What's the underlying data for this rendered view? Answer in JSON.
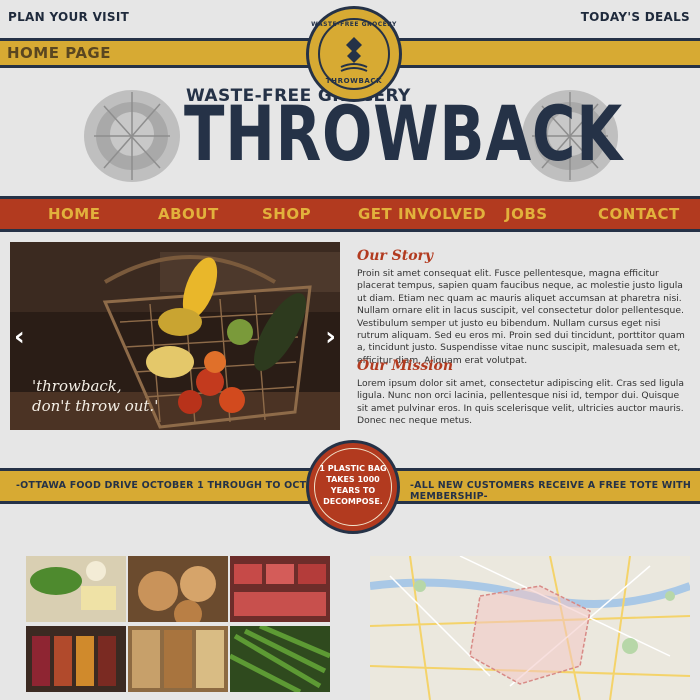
{
  "topbar": {
    "left_link": "PLAN YOUR VISIT",
    "right_link": "TODAY'S DEALS"
  },
  "home_band": {
    "label": "HOME PAGE"
  },
  "seal": {
    "ring_top": "WASTE-FREE GROCERY",
    "ring_bottom": "THROWBACK"
  },
  "header": {
    "tagline": "WASTE-FREE GROCERY",
    "brand": "THROWBACK"
  },
  "nav": {
    "items": [
      "HOME",
      "ABOUT",
      "SHOP",
      "GET INVOLVED",
      "JOBS",
      "CONTACT"
    ]
  },
  "slider": {
    "caption_line1": "'throwback,",
    "caption_line2": "don't throw out.'",
    "prev_icon": "chevron-left-icon",
    "next_icon": "chevron-right-icon"
  },
  "story": {
    "heading": "Our Story",
    "body": "Proin sit amet consequat elit. Fusce pellentesque, magna efficitur placerat tempus, sapien quam faucibus neque, ac molestie justo ligula ut diam. Etiam nec quam ac mauris aliquet accumsan at pharetra nisi. Nullam ornare elit in lacus suscipit, vel consectetur dolor pellentesque. Vestibulum semper ut justo eu bibendum. Nullam cursus eget nisi rutrum aliquam. Sed eu eros mi. Proin sed dui tincidunt, porttitor quam a, tincidunt justo. Suspendisse vitae nunc suscipit, malesuada sem et, efficitur diam. Aliquam erat volutpat."
  },
  "mission": {
    "heading": "Our Mission",
    "body": "Lorem ipsum dolor sit amet, consectetur adipiscing elit. Cras sed ligula ligula. Nunc non orci lacinia, pellentesque nisi id, tempor dui. Quisque sit amet pulvinar eros. In quis scelerisque velit, ultricies auctor mauris. Donec nec neque metus."
  },
  "promo": {
    "left": "-OTTAWA FOOD DRIVE OCTOBER 1 THROUGH TO OCTOBER 31-",
    "right": "-ALL NEW CUSTOMERS RECEIVE A FREE TOTE WITH MEMBERSHIP-",
    "badge_line1": "1 PLASTIC BAG",
    "badge_line2": "TAKES 1000",
    "badge_line3": "YEARS TO",
    "badge_line4": "DECOMPOSE."
  },
  "colors": {
    "navy": "#253247",
    "gold": "#d7aa33",
    "rust": "#b23a1f",
    "background": "#e6e6e6"
  }
}
